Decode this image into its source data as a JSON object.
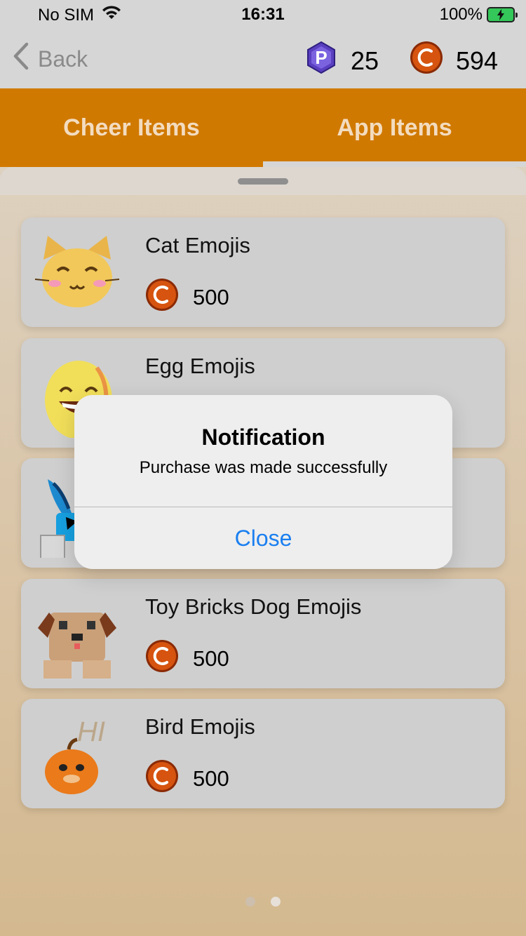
{
  "status_bar": {
    "carrier": "No SIM",
    "time": "16:31",
    "battery": "100%"
  },
  "nav": {
    "back_label": "Back",
    "premium_points": "25",
    "coins": "594"
  },
  "tabs": [
    {
      "label": "Cheer Items"
    },
    {
      "label": "App Items"
    }
  ],
  "items": [
    {
      "name": "Cat Emojis",
      "price": "500",
      "icon": "cat-face-icon"
    },
    {
      "name": "Egg Emojis",
      "icon": "egg-face-icon"
    },
    {
      "icon": "bunny-icon"
    },
    {
      "name": "Toy Bricks Dog Emojis",
      "price": "500",
      "icon": "brick-dog-icon"
    },
    {
      "name": "Bird Emojis",
      "price": "500",
      "icon": "bird-icon",
      "thumb_text": "HI"
    }
  ],
  "alert": {
    "title": "Notification",
    "message": "Purchase was made successfully",
    "close_label": "Close"
  },
  "colors": {
    "tab_bar": "#d07900",
    "tab_text": "#f3dcc0",
    "alert_button": "#1a7ff0",
    "coin": "#c9480a",
    "premium": "#5a3fc0"
  }
}
